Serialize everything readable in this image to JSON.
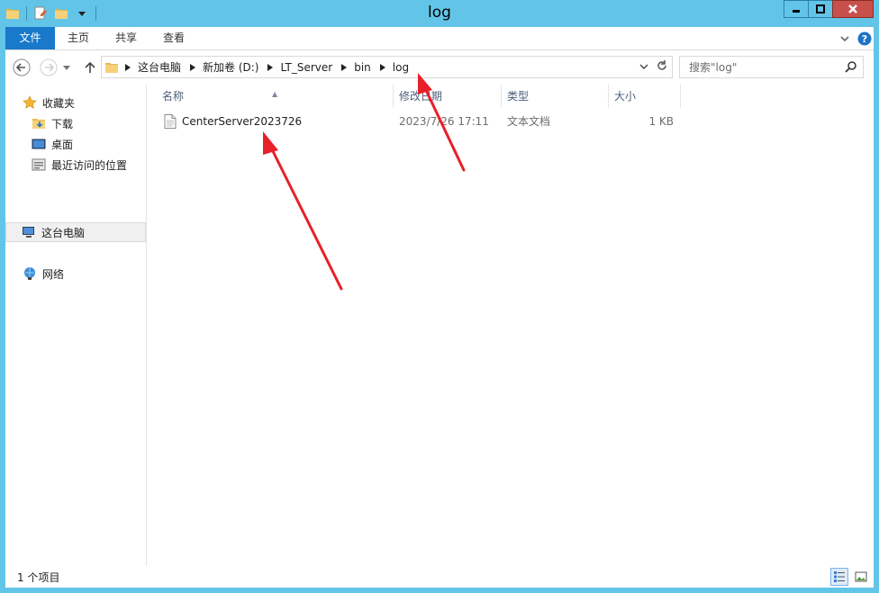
{
  "window": {
    "title": "log"
  },
  "ribbon": {
    "tabs": [
      {
        "label": "文件"
      },
      {
        "label": "主页"
      },
      {
        "label": "共享"
      },
      {
        "label": "查看"
      }
    ]
  },
  "address": {
    "crumbs": [
      "这台电脑",
      "新加卷 (D:)",
      "LT_Server",
      "bin",
      "log"
    ]
  },
  "search": {
    "placeholder": "搜索\"log\""
  },
  "navpane": {
    "favorites": {
      "label": "收藏夹",
      "items": [
        {
          "label": "下载"
        },
        {
          "label": "桌面"
        },
        {
          "label": "最近访问的位置"
        }
      ]
    },
    "thispc": {
      "label": "这台电脑"
    },
    "network": {
      "label": "网络"
    }
  },
  "filelist": {
    "columns": {
      "name": "名称",
      "modified": "修改日期",
      "type": "类型",
      "size": "大小"
    },
    "rows": [
      {
        "name": "CenterServer2023726",
        "modified": "2023/7/26 17:11",
        "type": "文本文档",
        "size": "1 KB"
      }
    ]
  },
  "status": {
    "text": "1 个项目"
  },
  "colors": {
    "frame": "#62c5e8",
    "file_tab": "#1979ca",
    "close_button": "#c7504b",
    "annotation": "#e8202a"
  }
}
